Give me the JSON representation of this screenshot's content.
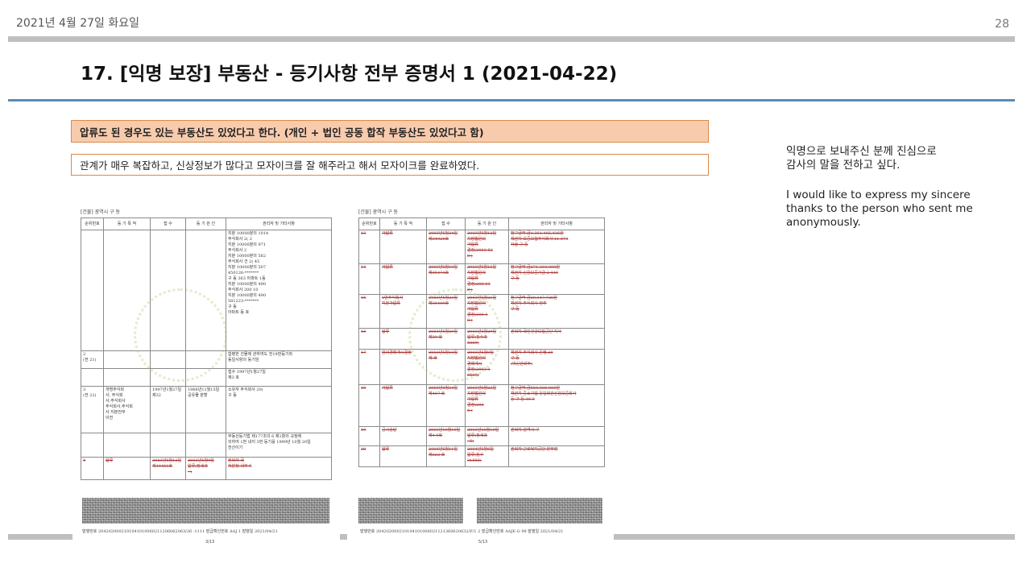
{
  "header": {
    "date": "2021년 4월 27일 화요일",
    "page_number": "28"
  },
  "slide": {
    "title": "17. [익명 보장] 부동산 - 등기사항 전부 증명서 1 (2021-04-22)",
    "highlight_note": "압류도 된 경우도 있는 부동산도 있었다고 한다. (개인 + 법인 공동 합작 부동산도 있었다고 함)",
    "info_note": "관계가 매우 복잡하고, 신상정보가 많다고 모자이크를 잘 해주라고 해서 모자이크를 완료하였다.",
    "side_korean": "익명으로 보내주신 분께 진심으로\n감사의 말을 전하고 싶다.",
    "side_english": "I would like to express my sincere thanks to the person who sent me anonymously."
  },
  "doc_left": {
    "heading": "[건물]   광역시    구    동",
    "columns": [
      "순위번호",
      "등 기 목 적",
      "접  수",
      "등 기 원 인",
      "권리자 및 기타사항"
    ],
    "rows": [
      [
        "",
        "",
        "",
        "",
        "지분 10000분의 1014\n주식회사 2(   2\n지분 10000분의 971\n주식회사 2\n지분 10000분의 582\n주식회사   건 2(   45\n지분 10000분의 507\n450126-*******\n구  동 363  아파트 1동\n지분 10000분의 490\n주식회사  200   10\n지분 10000분의 490\n581223-*******\n구   동\n아파트  동   호"
      ],
      [
        "2\n(전 21)",
        "",
        "",
        "",
        "합병한 건물에 관하여도 전19번등기와\n동일사항의 등기임"
      ],
      [
        "",
        "",
        "",
        "",
        "접수 1997년1월27일\n제3  호"
      ],
      [
        "3\n(전 22)",
        "개명주식회\n사,    주식회\n사,주식회사\n주식회사,주식회\n사    지분전부\n이전",
        "1997년1월27일\n제32  ",
        "1966년11월15일\n공유물 분할",
        "소유자  주식회사     20(\n구    동"
      ],
      [
        "",
        "",
        "",
        "",
        "부동산등기법 제177조의 6 제1항의 규정에\n의하여 1번 내지 3번 등기를 1999년 10월 20일\n전산이기"
      ],
      [
        "4",
        "압류",
        "2003년5월12일\n제18451호",
        "2003년5월9일\n압류(정세과\n-  )",
        "권리자  국\n처분청    세무서"
      ]
    ],
    "footer": "발행번호 2042020002101041010060211206062063/26   -1111      발급확인번호 AAJ       1    발행일 2021/04/21",
    "page": "3/13"
  },
  "doc_right": {
    "heading": "[건물]   광역시    구    동",
    "columns": [
      "순위번호",
      "등 기 목 적",
      "접  수",
      "등 기 원 인",
      "권리자 및 기타사항"
    ],
    "rows": [
      [
        "13",
        "가압류",
        "2003년5월24일\n제34929호",
        "2003년5월12일\n지방법원의\n가압류\n결정(2003  52\n8  )",
        "청구금액 금1,361,465,435원\n채권자  보증보험주식회사  11  074\n서울  구  동"
      ],
      [
        "14",
        "가압류",
        "2003년5월19일\n제35473호",
        "2003년5월16일\n지방법원의\n가압류\n결정(200  03\n8  )",
        "청구금액 금271,360,000원\n채권자  신용보증기금  2   449\n구  동"
      ],
      [
        "15",
        "1번주식회사\n지분가압류",
        "2003년5월23일\n제36409호",
        "2003년5월21일\n지방법원의\n가압류\n결정(200   3\n8  )",
        "청구금액 금20,347,728원\n채권자  주식회사  전주\n구  동"
      ],
      [
        "16",
        "압류",
        "2003년5월29일\n제39  호",
        "2003년5월29일\n압류(징수과\n5869)",
        "권리자  국민건강보험공단     지사"
      ],
      [
        "17",
        "임의경매개시결정",
        "2003년5월10일\n제  호",
        "2003년5월9일\n지방법원의\n경매개시\n결정(2003  1\n6539)",
        "채권자  주식회사   은행  20\n구  동\n(여신관리부)"
      ],
      [
        "18",
        "가압류",
        "2003년8월24일\n제407  호",
        "2003년8월22일\n지방법원의\n가압류\n결정(200  \n6  )",
        "청구금액 금550,000,000원\n채권자  중소기업   동일화관신용보증회사\n동    구   동 16-3"
      ],
      [
        "19",
        "공시송달",
        "2003년10월10일\n제4  9호",
        "2003년10월10일\n압류(정세과\n-    5)",
        "권리자     광역시   구"
      ],
      [
        "20",
        "압류",
        "2004년5월11일\n제222  호",
        "2004년5월6일\n압류(징수\n  31666)",
        "권리자  근로복지공단    본부장"
      ]
    ],
    "footer": "발행번호 204202000210104101006021121360620632/F/1    2     발급확인번호 AAJE-G    98   발행일 2021/04/21",
    "page": "5/13"
  }
}
